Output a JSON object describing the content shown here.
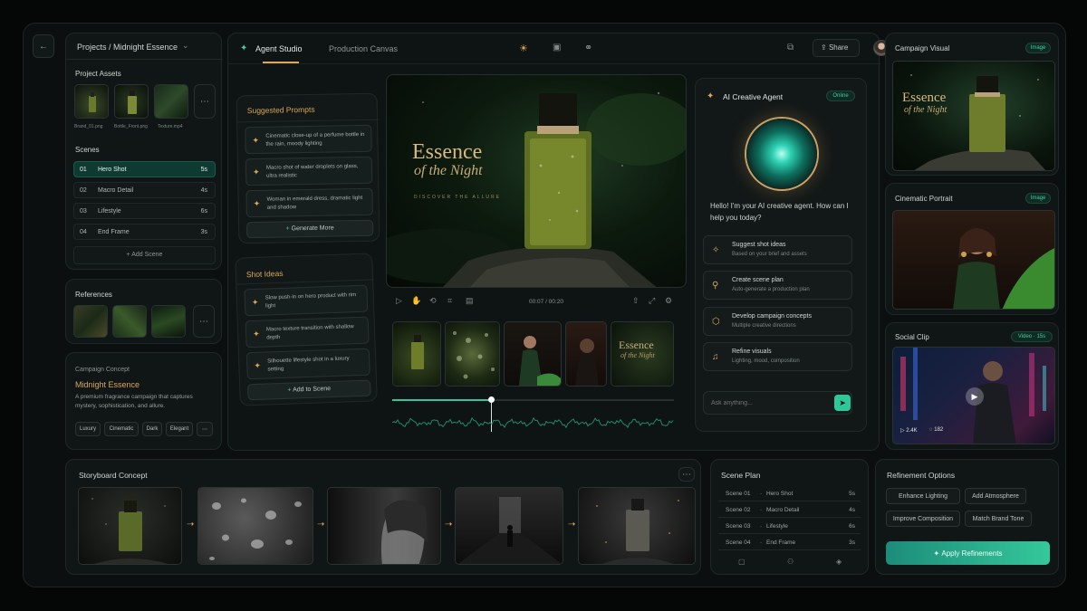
{
  "breadcrumb": "Projects / Midnight Essence",
  "project_assets": {
    "title": "Project Assets",
    "items": [
      "Brand_01.png",
      "Bottle_Front.png",
      "Texture.mp4"
    ]
  },
  "scenes": {
    "title": "Scenes",
    "rows": [
      {
        "num": "01",
        "name": "Hero Shot",
        "dur": "5s"
      },
      {
        "num": "02",
        "name": "Macro Detail",
        "dur": "4s"
      },
      {
        "num": "03",
        "name": "Lifestyle",
        "dur": "6s"
      },
      {
        "num": "04",
        "name": "End Frame",
        "dur": "3s"
      }
    ],
    "add": "Add Scene"
  },
  "references": {
    "title": "References"
  },
  "concept": {
    "label": "Campaign Concept",
    "name": "Midnight Essence",
    "desc": "A premium fragrance campaign that captures mystery, sophistication, and allure.",
    "tags": [
      "Luxury",
      "Cinematic",
      "Dark",
      "Elegant"
    ]
  },
  "tabs": {
    "agent": "Agent Studio",
    "canvas": "Production Canvas"
  },
  "share": "Share",
  "suggested": {
    "title": "Suggested Prompts",
    "items": [
      "Cinematic close-up of a perfume bottle in the rain, moody lighting",
      "Macro shot of water droplets on glass, ultra realistic",
      "Woman in emerald dress, dramatic light and shadow"
    ],
    "more": "Generate More"
  },
  "shots": {
    "title": "Shot Ideas",
    "items": [
      "Slow push-in on hero product with rim light",
      "Macro texture transition with shallow depth",
      "Silhouette lifestyle shot in a luxury setting"
    ],
    "add": "Add to Scene"
  },
  "preview": {
    "title1": "Essence",
    "title2": "of the Night",
    "tagline": "DISCOVER THE ALLURE"
  },
  "timeline": {
    "time": "00:07 / 00:20",
    "playhead": 0.35
  },
  "agent": {
    "title": "AI Creative Agent",
    "status": "Online",
    "greeting": "Hello! I'm your AI creative agent. How can I help you today?",
    "actions": [
      {
        "h": "Suggest shot ideas",
        "s": "Based on your brief and assets"
      },
      {
        "h": "Create scene plan",
        "s": "Auto-generate a production plan"
      },
      {
        "h": "Develop campaign concepts",
        "s": "Multiple creative directions"
      },
      {
        "h": "Refine visuals",
        "s": "Lighting, mood, composition"
      }
    ],
    "placeholder": "Ask anything..."
  },
  "right": {
    "visual": {
      "title": "Campaign Visual",
      "badge": "Image",
      "t1": "Essence",
      "t2": "of the Night"
    },
    "portrait": {
      "title": "Cinematic Portrait",
      "badge": "Image"
    },
    "social": {
      "title": "Social Clip",
      "badge": "Video · 15s",
      "likes": "2.4K",
      "comments": "182"
    }
  },
  "storyboard": {
    "title": "Storyboard Concept"
  },
  "plan": {
    "title": "Scene Plan",
    "rows": [
      {
        "s": "Scene 01",
        "n": "Hero Shot",
        "d": "5s"
      },
      {
        "s": "Scene 02",
        "n": "Macro Detail",
        "d": "4s"
      },
      {
        "s": "Scene 03",
        "n": "Lifestyle",
        "d": "6s"
      },
      {
        "s": "Scene 04",
        "n": "End Frame",
        "d": "3s"
      }
    ]
  },
  "refine": {
    "title": "Refinement Options",
    "opts": [
      "Enhance Lighting",
      "Add Atmosphere",
      "Improve Composition",
      "Match Brand Tone"
    ],
    "apply": "Apply Refinements"
  },
  "colors": {
    "accent": "#2fc79a",
    "gold": "#d9a85a",
    "bg": "#0b0f0f"
  }
}
